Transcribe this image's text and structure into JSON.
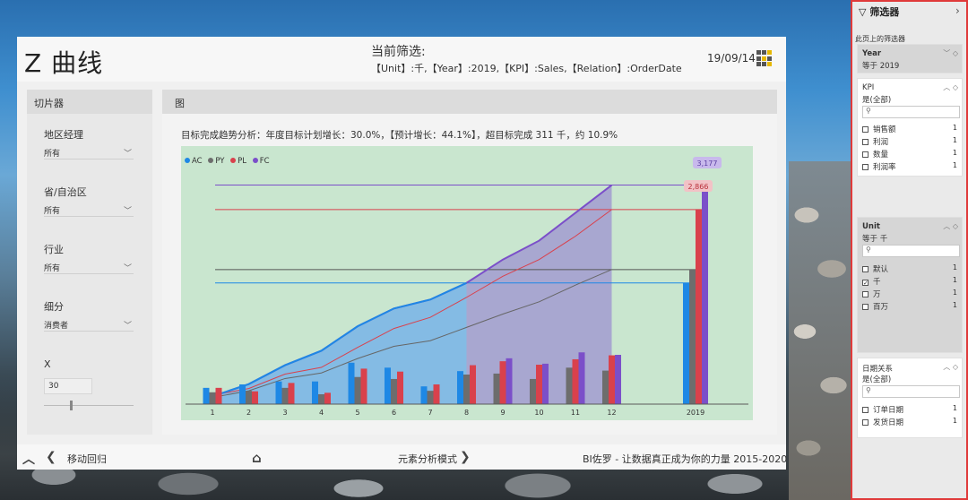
{
  "report": {
    "title": "Z 曲线",
    "filter_heading": "当前筛选:",
    "filter_text": "【Unit】:千,【Year】:2019,【KPI】:Sales,【Relation】:OrderDate",
    "date": "19/09/14"
  },
  "slicer_panel": {
    "title": "切片器",
    "slicers": [
      {
        "label": "地区经理",
        "value": "所有"
      },
      {
        "label": "省/自治区",
        "value": "所有"
      },
      {
        "label": "行业",
        "value": "所有"
      },
      {
        "label": "细分",
        "value": "消费者"
      }
    ],
    "x": {
      "label": "X",
      "value": "30"
    }
  },
  "chart_panel": {
    "title": "图",
    "subtitle": "目标完成趋势分析：年度目标计划增长：30.0%，【预计增长：44.1%】，超目标完成 311 千，约 10.9%"
  },
  "chart_data": {
    "type": "bar",
    "categories": [
      "1",
      "2",
      "3",
      "4",
      "5",
      "6",
      "7",
      "8",
      "9",
      "10",
      "11",
      "12",
      "2019"
    ],
    "legend": [
      "AC",
      "PY",
      "PL",
      "FC"
    ],
    "colors": {
      "AC": "#1e88e5",
      "PY": "#6d6d6d",
      "PL": "#d9414c",
      "FC": "#7b4fc9"
    },
    "monthly": {
      "AC": [
        33,
        40,
        46,
        46,
        84,
        74,
        36,
        67,
        null,
        null,
        null,
        null
      ],
      "PY": [
        24,
        27,
        33,
        20,
        55,
        51,
        27,
        60,
        62,
        51,
        74,
        68
      ],
      "PL": [
        33,
        26,
        43,
        23,
        72,
        66,
        40,
        79,
        87,
        80,
        91,
        99
      ],
      "FC": [
        null,
        null,
        null,
        null,
        null,
        null,
        null,
        null,
        93,
        82,
        105,
        100
      ]
    },
    "cumulative": {
      "AC": [
        35,
        90,
        175,
        240,
        350,
        430,
        470,
        545,
        null,
        null,
        null,
        null
      ],
      "PY": [
        30,
        60,
        115,
        140,
        205,
        260,
        285,
        345,
        405,
        460,
        535,
        605
      ],
      "PL": [
        40,
        70,
        135,
        165,
        255,
        340,
        390,
        480,
        575,
        650,
        755,
        875
      ],
      "FC": [
        35,
        90,
        175,
        240,
        350,
        430,
        470,
        545,
        650,
        735,
        860,
        985
      ]
    },
    "annual": {
      "AC": 545,
      "PY": 605,
      "PL": 875,
      "FC": 985
    },
    "annual_labels": {
      "PL": "2,866",
      "FC": "3,177"
    },
    "ylim": [
      0,
      1100
    ]
  },
  "footer": {
    "back_label": "移动回归",
    "center_label": "元素分析模式",
    "credit": "BI佐罗 - 让数据真正成为你的力量 2015-2020"
  },
  "filters_pane": {
    "title": "筛选器",
    "subtitle": "此页上的筛选器",
    "cards": {
      "year": {
        "title": "Year",
        "sub": "等于 2019"
      },
      "kpi": {
        "title": "KPI",
        "sub": "是(全部)",
        "items": [
          {
            "label": "销售额",
            "count": "1",
            "checked": false
          },
          {
            "label": "利润",
            "count": "1",
            "checked": false
          },
          {
            "label": "数量",
            "count": "1",
            "checked": false
          },
          {
            "label": "利润率",
            "count": "1",
            "checked": false
          }
        ]
      },
      "unit": {
        "title": "Unit",
        "sub": "等于 千",
        "items": [
          {
            "label": "默认",
            "count": "1",
            "checked": false
          },
          {
            "label": "千",
            "count": "1",
            "checked": true
          },
          {
            "label": "万",
            "count": "1",
            "checked": false
          },
          {
            "label": "百万",
            "count": "1",
            "checked": false
          }
        ]
      },
      "relation": {
        "title": "日期关系",
        "sub": "是(全部)",
        "items": [
          {
            "label": "订单日期",
            "count": "1",
            "checked": false
          },
          {
            "label": "发货日期",
            "count": "1",
            "checked": false
          }
        ]
      }
    }
  }
}
